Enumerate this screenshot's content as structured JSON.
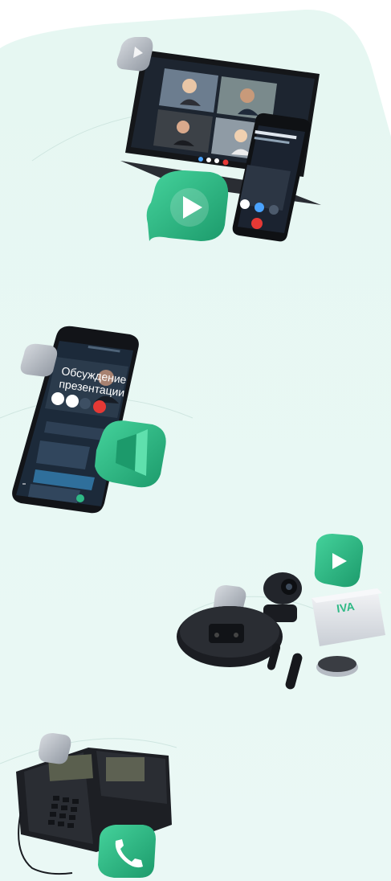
{
  "colors": {
    "background": "#ffffff",
    "mint_panel": "#e3f6f0",
    "brand_green": "#2fb986",
    "brand_green_dark": "#1f8f66",
    "silver": "#b9bfc7",
    "device_dark": "#1a1c21",
    "app_dark": "#1c2a3a"
  },
  "chat_screen": {
    "title_line1": "Обсуждение",
    "title_line2": "презентации"
  },
  "media_box": {
    "logo": "IVA"
  },
  "icons": [
    "play-badge-icon",
    "play-badge-silver-icon",
    "megaphone-icon",
    "phone-badge-icon",
    "decline-call-icon",
    "accept-call-icon"
  ]
}
